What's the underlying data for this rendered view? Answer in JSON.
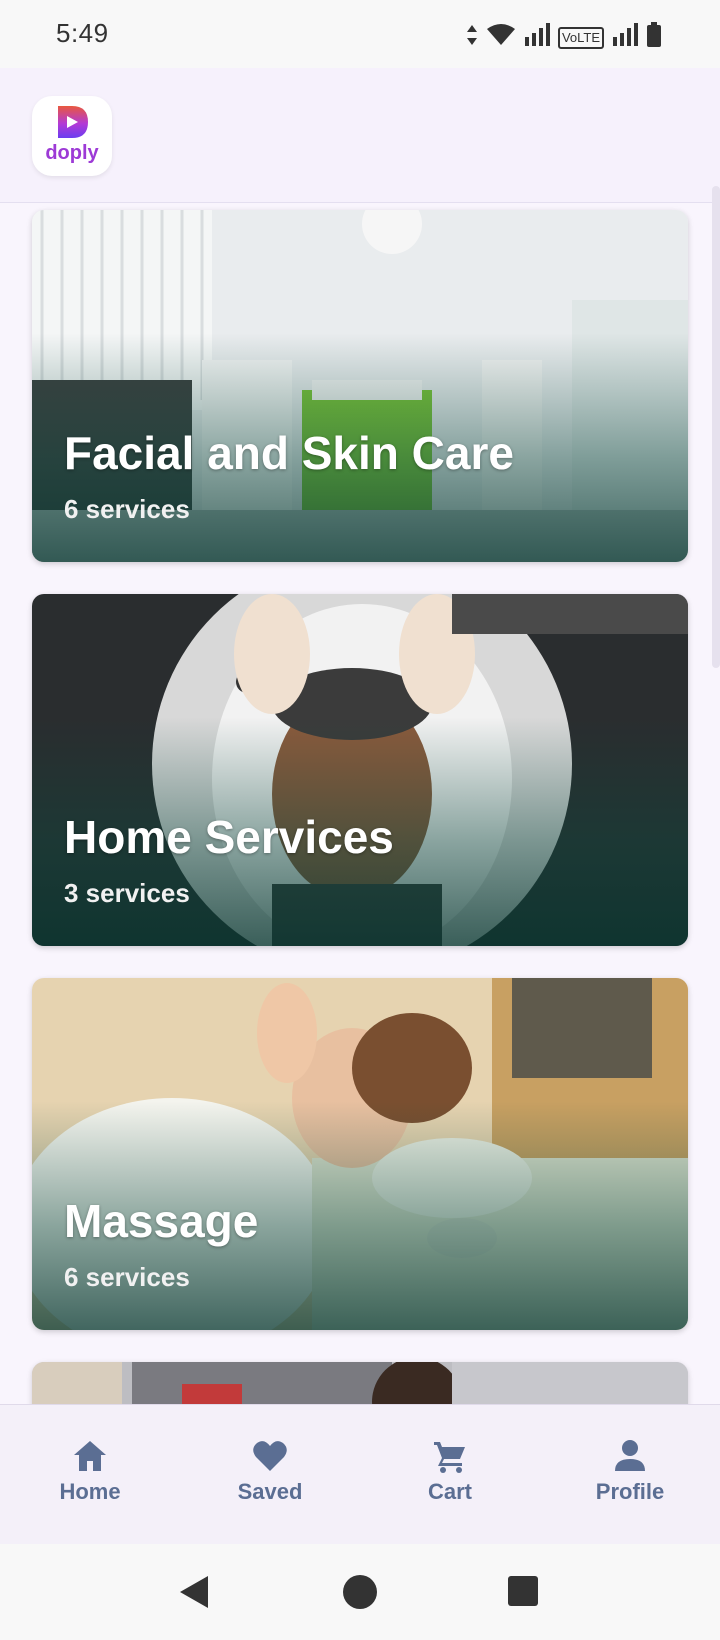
{
  "status_bar": {
    "time": "5:49",
    "icons": [
      "data-arrows-icon",
      "wifi-icon",
      "signal-icon",
      "volte-icon",
      "signal-icon",
      "battery-icon"
    ],
    "volte_label": "VoLTE"
  },
  "header": {
    "logo_text": "doply",
    "logo_colors": {
      "top": "#e8583e",
      "mid": "#b43ad6",
      "bottom": "#6a3cf0"
    }
  },
  "categories": [
    {
      "title": "Facial and Skin Care",
      "count_label": "6 services"
    },
    {
      "title": "Home Services",
      "count_label": "3 services"
    },
    {
      "title": "Massage",
      "count_label": "6 services"
    }
  ],
  "bottom_nav": [
    {
      "label": "Home",
      "icon": "home-icon"
    },
    {
      "label": "Saved",
      "icon": "heart-icon"
    },
    {
      "label": "Cart",
      "icon": "cart-icon"
    },
    {
      "label": "Profile",
      "icon": "person-icon"
    }
  ],
  "system_nav": [
    "back-icon",
    "home-circle-icon",
    "recents-icon"
  ],
  "colors": {
    "nav_icon": "#5b6e93",
    "background": "#f9f5fd",
    "card_overlay": "#0c463c"
  }
}
